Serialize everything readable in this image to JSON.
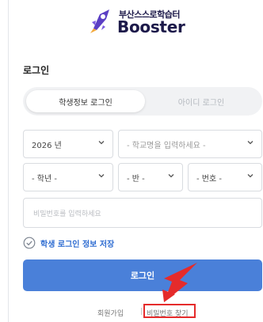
{
  "logo": {
    "korean": "부산스스로학습터",
    "english": "Booster"
  },
  "section_title": "로그인",
  "tabs": [
    {
      "label": "학생정보 로그인",
      "active": true
    },
    {
      "label": "아이디 로그인",
      "active": false
    }
  ],
  "year_select": {
    "value": "2026 년"
  },
  "school_select": {
    "placeholder": "- 학교명을 입력하세요 -"
  },
  "grade_select": {
    "value": "- 학년 -"
  },
  "class_select": {
    "value": "- 반 -"
  },
  "number_select": {
    "value": "- 번호 -"
  },
  "password": {
    "placeholder": "비밀번호를 입력하세요"
  },
  "remember_label": "학생 로그인 정보 저장",
  "login_button": "로그인",
  "footer": {
    "signup": "회원가입",
    "separator": "|",
    "find_password": "비밀번호 찾기"
  },
  "colors": {
    "accent": "#4a80d9",
    "highlight": "#e52b2b",
    "remember": "#2e6cd1"
  }
}
